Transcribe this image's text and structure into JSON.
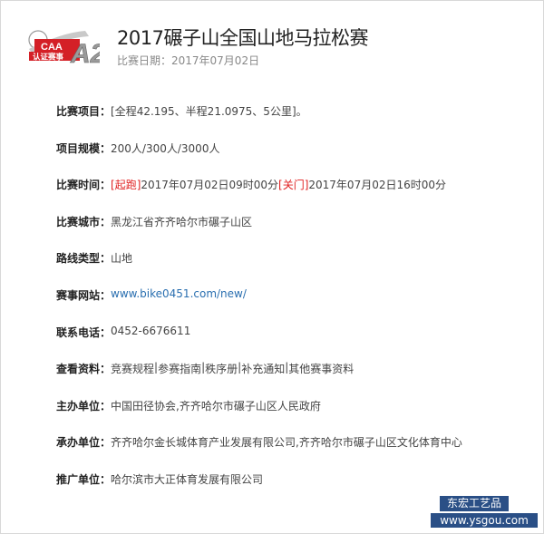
{
  "header": {
    "title": "2017碾子山全国山地马拉松赛",
    "date": "比赛日期：2017年07月02日"
  },
  "badge": {
    "caa_text": "CAA",
    "cert_text": "认证赛事",
    "level_text": "A2",
    "color": "#d42027"
  },
  "rows": [
    {
      "label": "比赛项目：",
      "value": "[全程42.195、半程21.0975、5公里]。"
    },
    {
      "label": "项目规模：",
      "value": "200人/300人/3000人"
    },
    {
      "label": "比赛时间：",
      "start_tag": "[起跑]",
      "start_value": "2017年07月02日09时00分 ",
      "end_tag": "[关门]",
      "end_value": "2017年07月02日16时00分"
    },
    {
      "label": "比赛城市：",
      "value": "黑龙江省齐齐哈尔市碾子山区"
    },
    {
      "label": "路线类型：",
      "value": "山地"
    },
    {
      "label": "赛事网站：",
      "value": "www.bike0451.com/new/"
    },
    {
      "label": "联系电话：",
      "value": "0452-6676611"
    },
    {
      "label": "查看资料：",
      "links": [
        "竞赛规程",
        "参赛指南",
        "秩序册",
        "补充通知",
        "其他赛事资料"
      ]
    },
    {
      "label": "主办单位：",
      "value": "中国田径协会,齐齐哈尔市碾子山区人民政府"
    },
    {
      "label": "承办单位：",
      "value": "齐齐哈尔金长城体育产业发展有限公司,齐齐哈尔市碾子山区文化体育中心"
    },
    {
      "label": "推广单位：",
      "value": "哈尔滨市大正体育发展有限公司"
    }
  ],
  "watermark": {
    "line1": "东宏工艺品",
    "line2": "www.ysgou.com"
  },
  "colors": {
    "link": "#2a6fb0",
    "red": "#e02020",
    "watermark_bg": "#2a4f86"
  }
}
